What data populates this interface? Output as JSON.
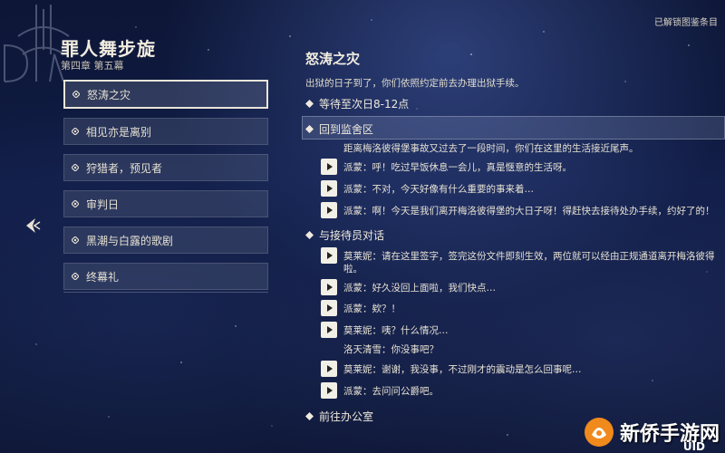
{
  "header": {
    "title": "罪人舞步旋",
    "chapter": "第四章 第五幕",
    "top_right_note": "已解锁图鉴条目"
  },
  "quest_list": [
    {
      "label": "怒涛之灾",
      "selected": true
    },
    {
      "label": "相见亦是离别",
      "selected": false
    },
    {
      "label": "狩猎者，预见者",
      "selected": false
    },
    {
      "label": "审判日",
      "selected": false
    },
    {
      "label": "黑潮与白露的歌剧",
      "selected": false
    },
    {
      "label": "终幕礼",
      "selected": false
    }
  ],
  "detail": {
    "title": "怒涛之灾",
    "description": "出狱的日子到了，你们依照约定前去办理出狱手续。",
    "steps": {
      "wait": "等待至次日8-12点",
      "return": "回到监舍区",
      "talk": "与接待员对话",
      "office": "前往办公室"
    },
    "narration_1": "距离梅洛彼得堡事故又过去了一段时间，你们在这里的生活接近尾声。",
    "dialogues_1": [
      "派蒙：呼！吃过早饭休息一会儿，真是惬意的生活呀。",
      "派蒙：不对，今天好像有什么重要的事来着…",
      "派蒙：啊！今天是我们离开梅洛彼得堡的大日子呀！得赶快去接待处办手续，约好了的！"
    ],
    "dialogues_2": {
      "line1a": "莫莱妮：请在这里签字，签完这份文件即刻生效，两位就可以经由正规通道离开梅洛彼得",
      "line1b": "啦。",
      "line2": "派蒙：好久没回上面啦，我们快点…",
      "line3": "派蒙：欸？！",
      "line4": "莫莱妮：咦？什么情况…",
      "narr": "洛天清雪：你没事吧？",
      "line5": "莫莱妮：谢谢，我没事，不过刚才的震动是怎么回事呢…",
      "line6": "派蒙：去问问公爵吧。"
    }
  },
  "watermark": {
    "text": "新侨手游网",
    "uid": "UID"
  },
  "colors": {
    "accent": "#e9e5da",
    "panel": "#5a6482",
    "bg": "#101c45"
  }
}
